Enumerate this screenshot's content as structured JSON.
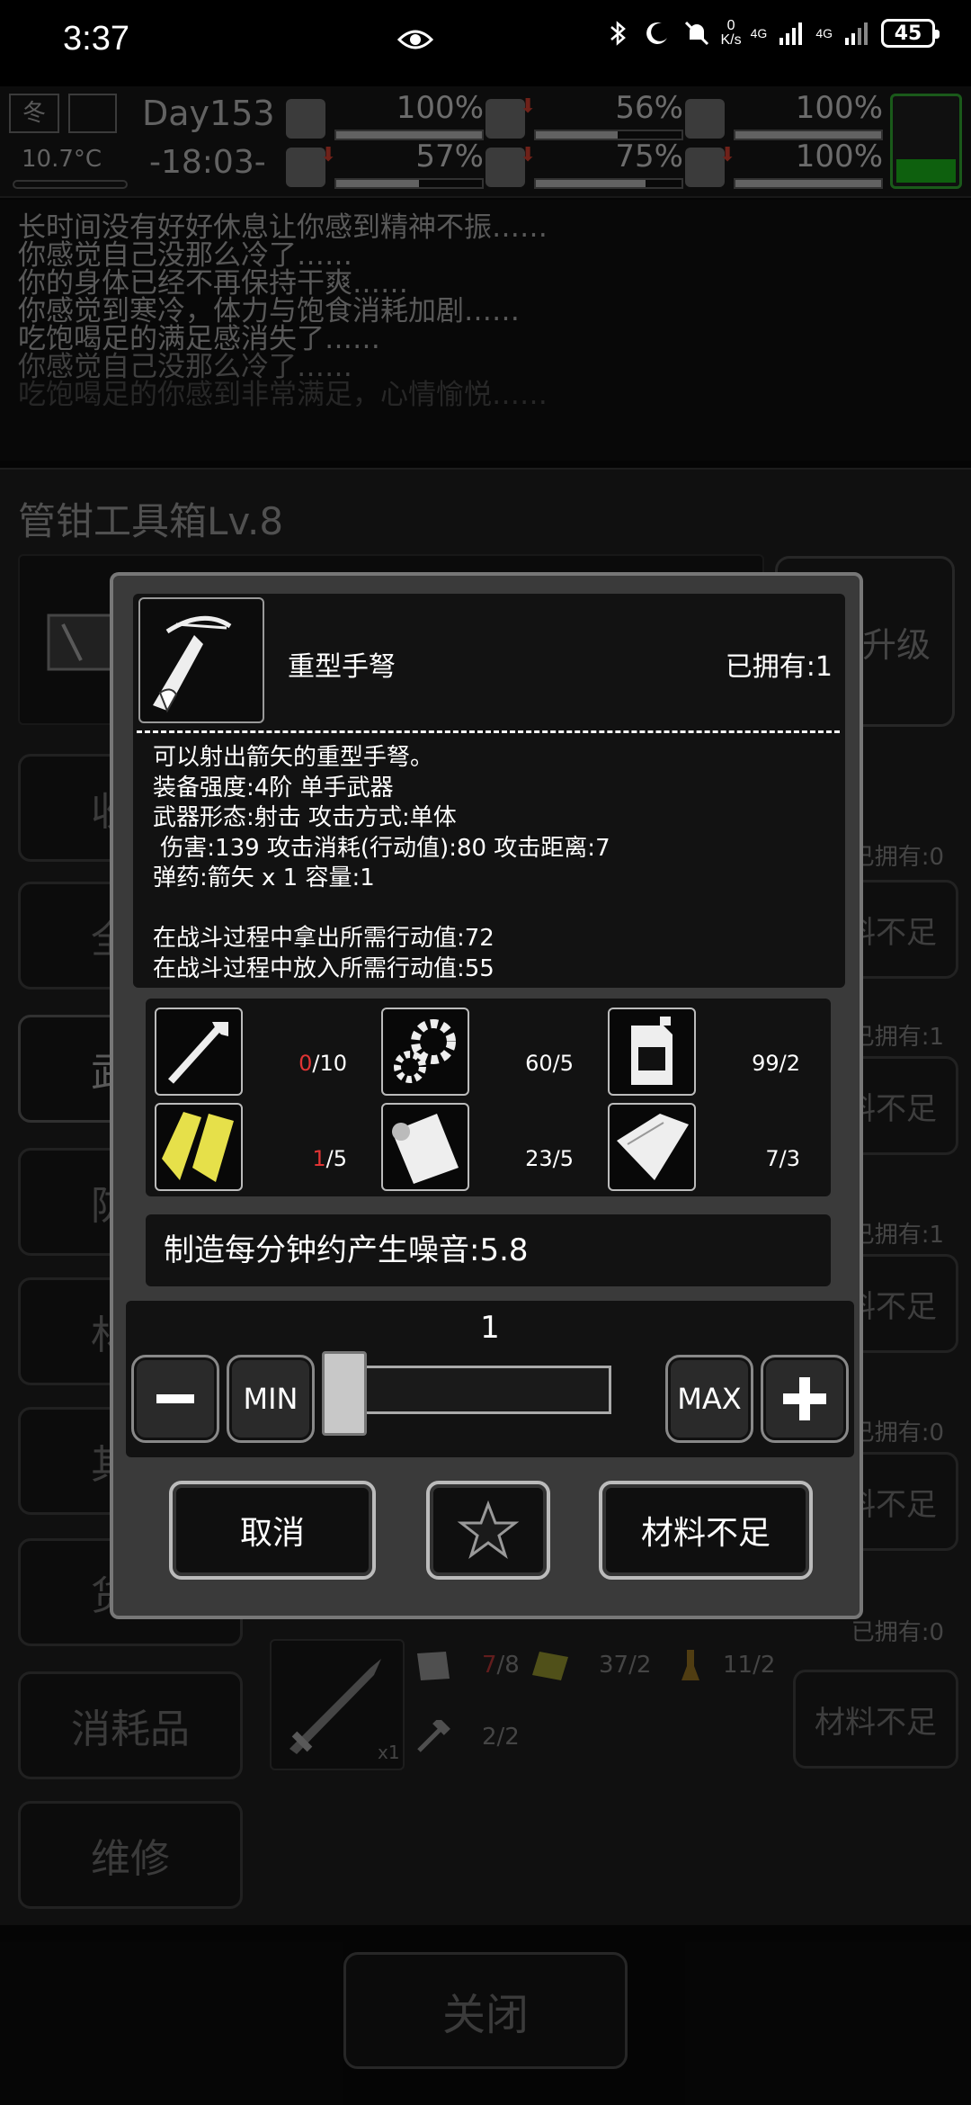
{
  "status_bar": {
    "time": "3:37",
    "net_speed_value": "0",
    "net_speed_unit": "K/s",
    "signal1": "4G",
    "signal2": "4G",
    "battery": "45"
  },
  "hud": {
    "season": "冬",
    "temperature": "10.7°C",
    "day": "Day153",
    "clock": "-18:03-",
    "stats": [
      {
        "name": "health",
        "value": "100%",
        "level": 1.0
      },
      {
        "name": "hunger",
        "value": "56%",
        "level": 0.56,
        "falling": true
      },
      {
        "name": "water",
        "value": "100%",
        "level": 1.0
      },
      {
        "name": "stamina",
        "value": "57%",
        "level": 0.57,
        "falling": true
      },
      {
        "name": "thirst",
        "value": "75%",
        "level": 0.75,
        "falling": true
      },
      {
        "name": "mood",
        "value": "100%",
        "level": 1.0,
        "falling": true
      }
    ],
    "energy_color": "#19a619"
  },
  "log": {
    "lines": [
      "长时间没有好好休息让你感到精神不振……",
      "你感觉自己没那么冷了……",
      "你的身体已经不再保持干爽……",
      "你感觉到寒冷，体力与饱食消耗加剧……",
      "吃饱喝足的满足感消失了……",
      "你感觉自己没那么冷了……",
      "吃饱喝足的你感到非常满足，心情愉悦……"
    ]
  },
  "bench": {
    "title": "管钳工具箱Lv.8",
    "upgrade_label": "升级",
    "sidebar": [
      "收藏",
      "全部",
      "武器",
      "防具",
      "材料",
      "其他",
      "货币",
      "消耗品",
      "维修"
    ],
    "rows": [
      {
        "owned": "已拥有:0",
        "button": "材料不足"
      },
      {
        "owned": "已拥有:1",
        "button": "材料不足"
      },
      {
        "owned": "已拥有:1",
        "button": "材料不足"
      },
      {
        "owned": "已拥有:0",
        "button": "材料不足"
      }
    ],
    "bottom_item": {
      "owned": "已拥有:0",
      "button": "材料不足",
      "count": "x1",
      "materials": [
        {
          "icon": "cloth-icon",
          "have": "7",
          "need": "/8"
        },
        {
          "icon": "wood-plank-icon",
          "qty": "37/2"
        },
        {
          "icon": "flask-icon",
          "qty": "11/2"
        },
        {
          "icon": "hammer-icon",
          "qty": "2/2"
        }
      ]
    },
    "close_label": "关闭"
  },
  "modal": {
    "item_name": "重型手弩",
    "owned": "已拥有:1",
    "description": [
      "可以射出箭矢的重型手弩。",
      "装备强度:4阶 单手武器",
      "武器形态:射击 攻击方式:单体",
      " 伤害:139 攻击消耗(行动值):80 攻击距离:7",
      "弹药:箭矢 x 1 容量:1",
      "",
      "在战斗过程中拿出所需行动值:72",
      "在战斗过程中放入所需行动值:55"
    ],
    "materials": [
      {
        "icon": "wrench-rod-icon",
        "have": "0",
        "need": "/10",
        "short": true
      },
      {
        "icon": "gears-icon",
        "have": "60",
        "need": "/5",
        "short": false
      },
      {
        "icon": "fuel-can-icon",
        "have": "99",
        "need": "/2",
        "short": false
      },
      {
        "icon": "wood-plank-icon",
        "have": "1",
        "need": "/5",
        "short": true
      },
      {
        "icon": "paper-roll-icon",
        "have": "23",
        "need": "/5",
        "short": false
      },
      {
        "icon": "cloth-icon",
        "have": "7",
        "need": "/3",
        "short": false
      }
    ],
    "noise": "制造每分钟约产生噪音:5.8",
    "quantity": "1",
    "min_label": "MIN",
    "max_label": "MAX",
    "cancel_label": "取消",
    "confirm_label": "材料不足"
  }
}
